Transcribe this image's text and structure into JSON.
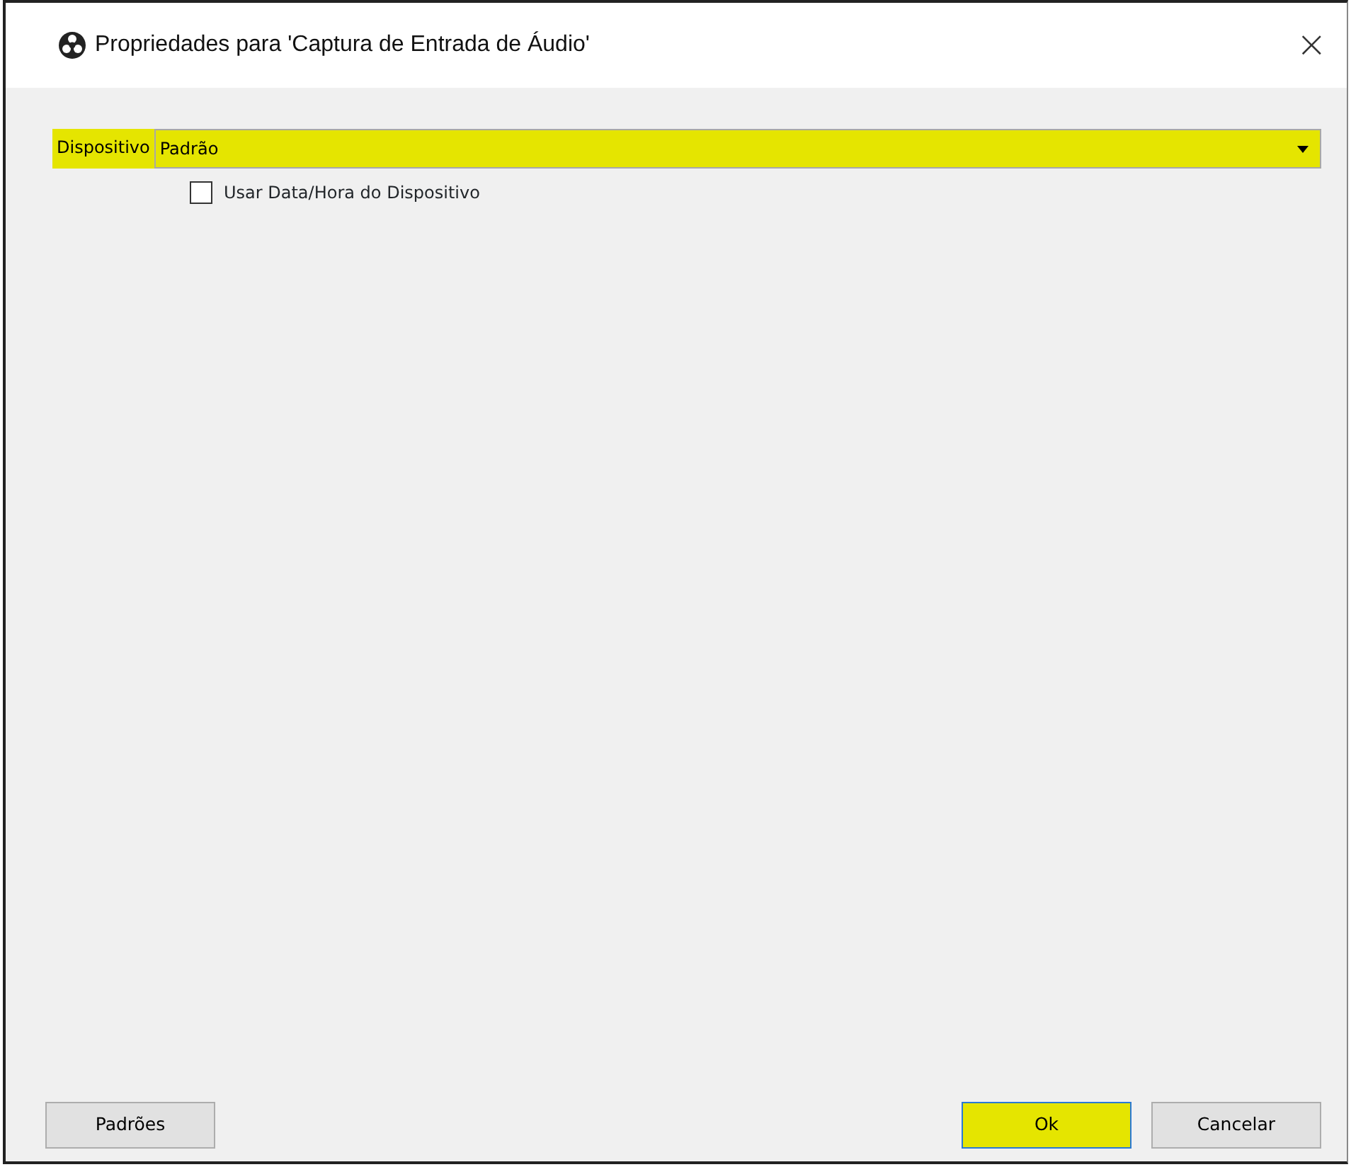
{
  "window": {
    "title": "Propriedades para 'Captura de Entrada de Áudio'",
    "close": "×"
  },
  "device": {
    "label": "Dispositivo",
    "value": "Padrão",
    "highlighted": true
  },
  "checkbox": {
    "label": "Usar Data/Hora do Dispositivo",
    "checked": false
  },
  "buttons": [
    {
      "label": "Padrões",
      "kind": "left",
      "highlighted": false
    },
    {
      "label": "Ok",
      "kind": "right",
      "highlighted": true
    },
    {
      "label": "Cancelar",
      "kind": "right",
      "highlighted": false
    }
  ]
}
